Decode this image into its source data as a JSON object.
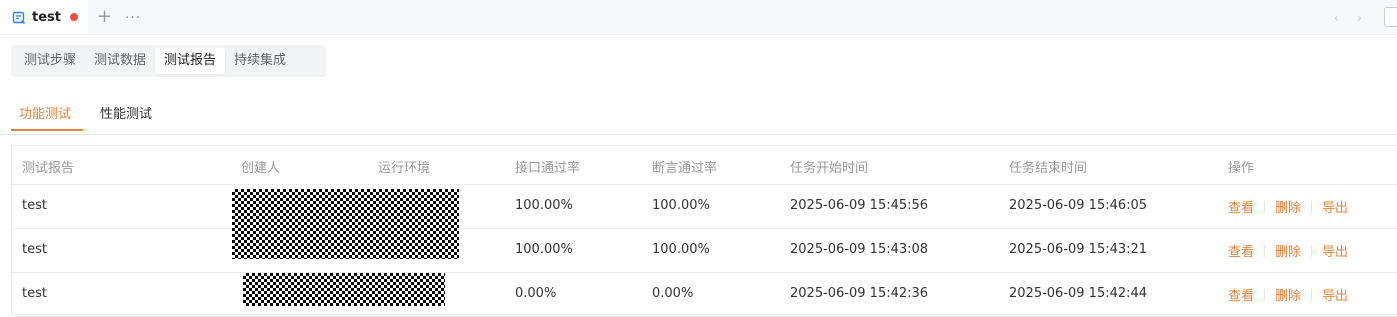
{
  "tab_bar": {
    "doc_title": "test",
    "icons": {
      "doc": "api-doc-icon",
      "unsaved": "unsaved-dot-icon",
      "add": "plus-icon",
      "more": "more-icon",
      "prev": "chevron-left-icon",
      "next": "chevron-right-icon"
    },
    "add_glyph": "+",
    "more_glyph": "···",
    "prev_glyph": "‹",
    "next_glyph": "›",
    "unsaved_color": "#f04e3e"
  },
  "segmented": {
    "items": [
      "测试步骤",
      "测试数据",
      "测试报告",
      "持续集成"
    ],
    "active": "测试报告"
  },
  "sub_tabs": {
    "items": [
      "功能测试",
      "性能测试"
    ],
    "active": "功能测试",
    "accent": "#e8833a"
  },
  "table": {
    "columns": [
      "测试报告",
      "创建人",
      "运行环境",
      "接口通过率",
      "断言通过率",
      "任务开始时间",
      "任务结束时间",
      "操作"
    ],
    "rows": [
      {
        "report": "test",
        "api_pass": "100.00%",
        "assert_pass": "100.00%",
        "start": "2025-06-09 15:45:56",
        "end": "2025-06-09 15:46:05"
      },
      {
        "report": "test",
        "api_pass": "100.00%",
        "assert_pass": "100.00%",
        "start": "2025-06-09 15:43:08",
        "end": "2025-06-09 15:43:21"
      },
      {
        "report": "test",
        "api_pass": "0.00%",
        "assert_pass": "0.00%",
        "start": "2025-06-09 15:42:36",
        "end": "2025-06-09 15:42:44"
      }
    ],
    "actions": {
      "view": "查看",
      "delete": "删除",
      "export": "导出"
    }
  }
}
